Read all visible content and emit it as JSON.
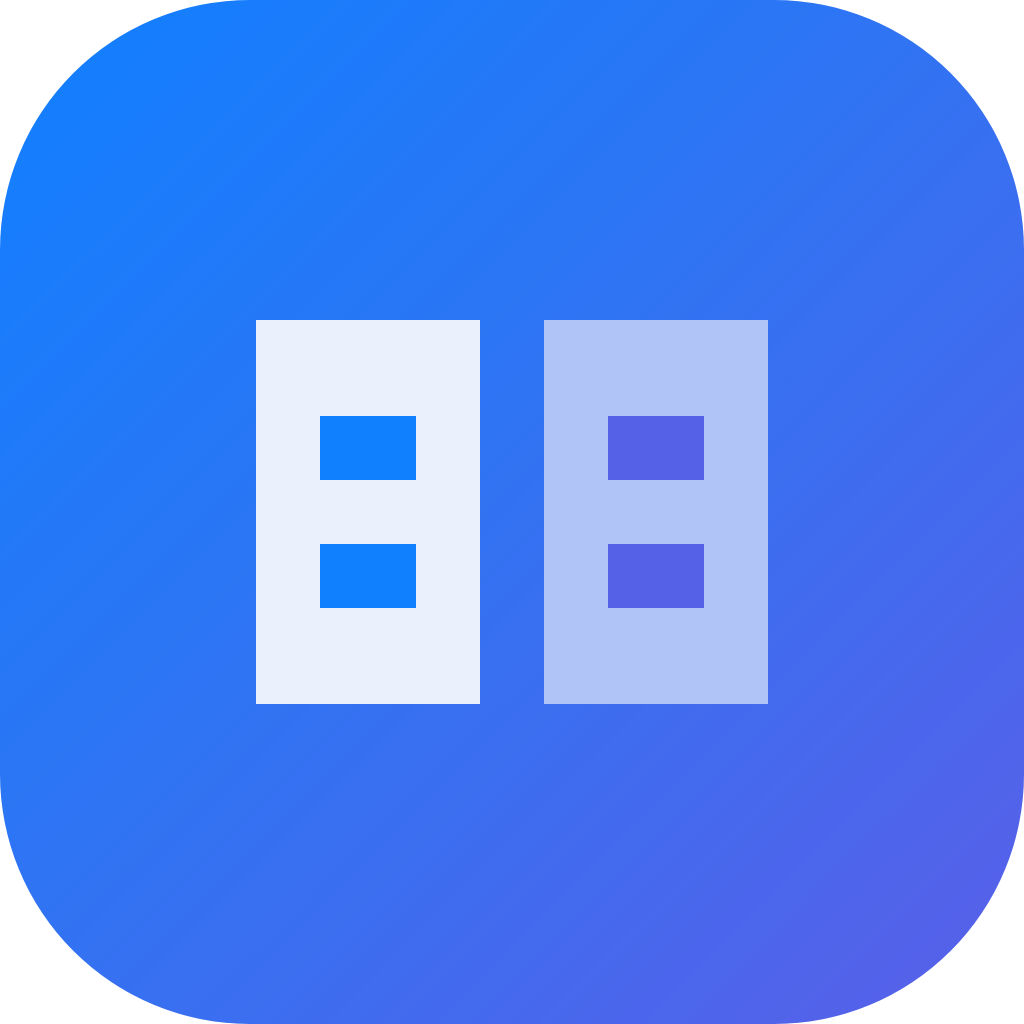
{
  "icon": {
    "name": "two-columns-app-icon",
    "colors": {
      "gradient_start": "#1080ff",
      "gradient_end": "#5a5fe8",
      "left_panel": "#eaf0fc",
      "right_panel": "#b0c4f7",
      "left_slots": "#1080ff",
      "right_slots": "#5562e8"
    }
  }
}
